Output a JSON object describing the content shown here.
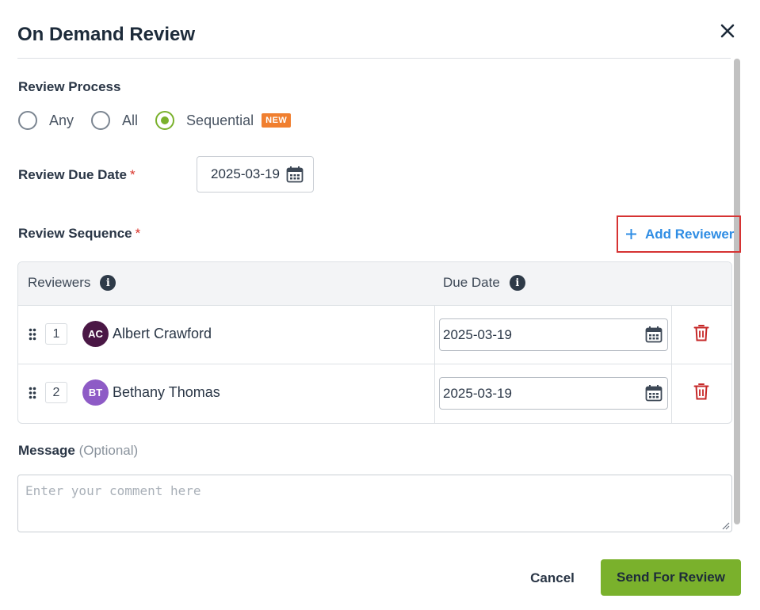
{
  "dialog": {
    "title": "On Demand Review"
  },
  "review_process": {
    "label": "Review Process",
    "options": [
      {
        "label": "Any",
        "checked": false
      },
      {
        "label": "All",
        "checked": false
      },
      {
        "label": "Sequential",
        "checked": true,
        "badge": "NEW"
      }
    ]
  },
  "review_due_date": {
    "label": "Review Due Date",
    "required_mark": "*",
    "value": "2025-03-19"
  },
  "review_sequence": {
    "label": "Review Sequence",
    "required_mark": "*",
    "add_button_label": "Add Reviewer",
    "columns": {
      "reviewers": "Reviewers",
      "due_date": "Due Date",
      "info_glyph": "i"
    },
    "rows": [
      {
        "order": "1",
        "initials": "AC",
        "name": "Albert Crawford",
        "due_date": "2025-03-19",
        "avatar_color": "#4a1745"
      },
      {
        "order": "2",
        "initials": "BT",
        "name": "Bethany Thomas",
        "due_date": "2025-03-19",
        "avatar_color": "#8e5bc6"
      }
    ]
  },
  "message": {
    "label": "Message",
    "optional_note": "(Optional)",
    "placeholder": "Enter your comment here",
    "value": ""
  },
  "footer": {
    "cancel_label": "Cancel",
    "send_label": "Send For Review"
  },
  "colors": {
    "accent_green": "#7ab12c",
    "link_blue": "#2f8de4",
    "badge_orange": "#f07f2f",
    "delete_red": "#c62828",
    "highlight_red": "#d63333"
  }
}
